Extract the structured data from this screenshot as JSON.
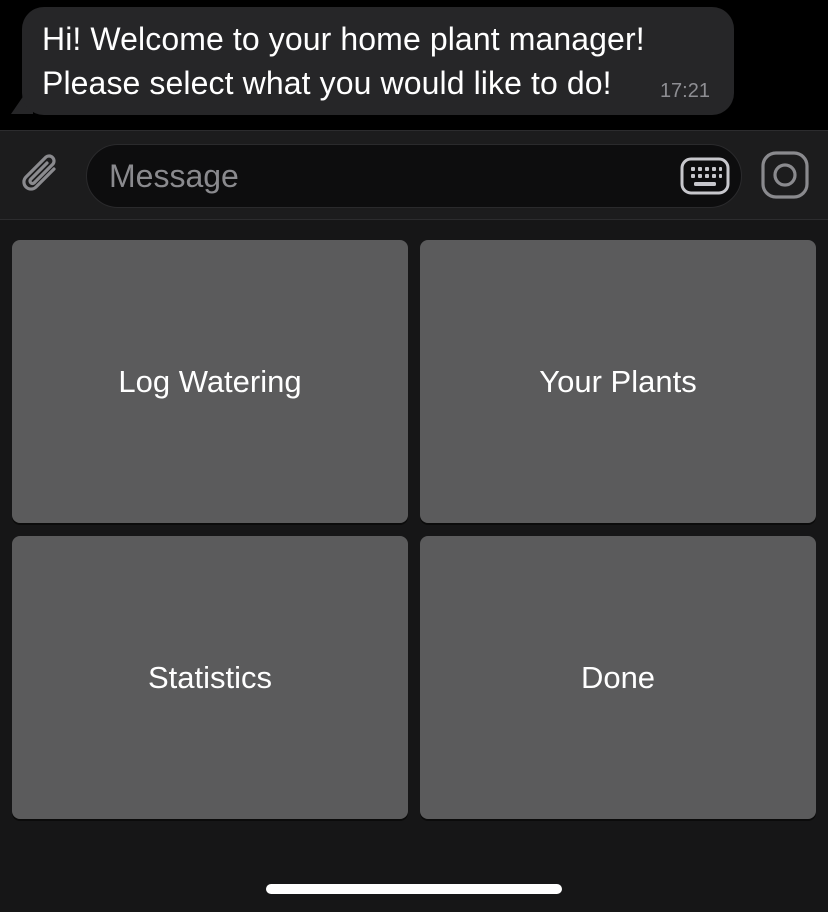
{
  "chat": {
    "message": {
      "line1": "Hi! Welcome to your home plant manager!",
      "line2": "Please select what you would like to do!",
      "time": "17:21"
    }
  },
  "input_bar": {
    "placeholder": "Message",
    "icons": {
      "attach": "paperclip-icon",
      "keyboard": "keyboard-icon",
      "camera": "camera-icon"
    }
  },
  "reply_keyboard": {
    "buttons": [
      {
        "label": "Log Watering"
      },
      {
        "label": "Your Plants"
      },
      {
        "label": "Statistics"
      },
      {
        "label": "Done"
      }
    ]
  },
  "colors": {
    "background": "#000000",
    "bubble": "#262628",
    "keyboard_bg": "#161617",
    "button": "#5b5b5c",
    "timestamp": "#8e8e93"
  }
}
